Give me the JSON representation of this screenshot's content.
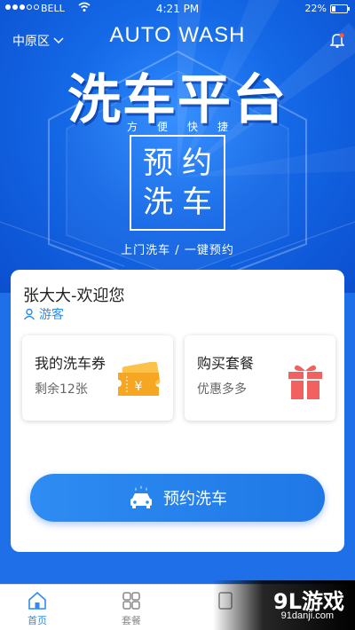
{
  "status_bar": {
    "carrier": "BELL",
    "time": "4:21 PM",
    "battery": "22%"
  },
  "header": {
    "district": "中原区",
    "brand_en": "AUTO WASH",
    "title": "洗车平台",
    "slogan": "方便快捷",
    "book_box_line1": "预约",
    "book_box_line2": "洗车",
    "tagline": "上门洗车 /  一键预约"
  },
  "user": {
    "greeting": "张大大-欢迎您",
    "role": "游客"
  },
  "tiles": [
    {
      "title": "我的洗车券",
      "subtitle": "剩余12张",
      "icon": "ticket-icon"
    },
    {
      "title": "购买套餐",
      "subtitle": "优惠多多",
      "icon": "gift-icon"
    }
  ],
  "book_button": {
    "label": "预约洗车",
    "icon": "car-wash-icon"
  },
  "tabbar": {
    "home": "首页",
    "package": "套餐"
  },
  "watermark": {
    "logo": "9L游戏",
    "url": "91danji.com"
  },
  "colors": {
    "primary": "#1e6fe8",
    "accent": "#2d8cf0",
    "ticket": "#f5a623",
    "gift": "#f0615f"
  }
}
